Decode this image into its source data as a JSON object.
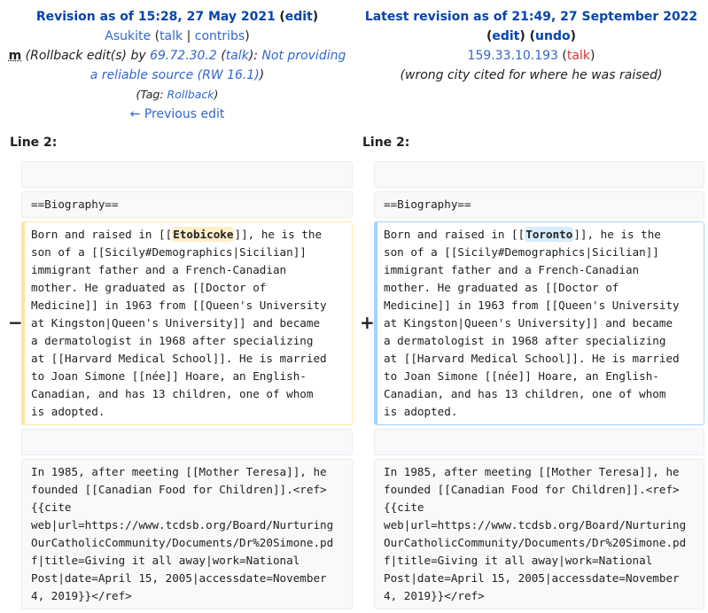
{
  "old": {
    "title": "Revision as of 15:28, 27 May 2021",
    "edit": "edit",
    "user": "Asukite",
    "talk": "talk",
    "contribs": "contribs",
    "minor": "m",
    "summary_prefix": "(Rollback edit(s) by ",
    "ip": "69.72.30.2",
    "ip_talk": "talk",
    "summary_link": "Not providing a reliable source (RW 16.1)",
    "tag_label": "Tag: ",
    "tag": "Rollback",
    "prev": "← Previous edit",
    "line": "Line 2:",
    "marker": "−"
  },
  "new": {
    "title": "Latest revision as of 21:49, 27 September 2022",
    "edit": "edit",
    "undo": "undo",
    "user": "159.33.10.193",
    "talk": "talk",
    "summary": "(wrong city cited for where he was raised)",
    "line": "Line 2:",
    "marker": "+"
  },
  "diff": {
    "bio": "==Biography==",
    "pre": "Born and raised in [[",
    "old_word": "Etobicoke",
    "new_word": "Toronto",
    "post": "]], he is the\nson of a [[Sicily#Demographics|Sicilian]]\nimmigrant father and a French-Canadian\nmother. He graduated as [[Doctor of\nMedicine]] in 1963 from [[Queen's University\nat Kingston|Queen's University]] and became\na dermatologist in 1968 after specializing\nat [[Harvard Medical School]]. He is married\nto Joan Simone [[née]] Hoare, an English-\nCanadian, and has 13 children, one of whom\nis adopted.",
    "para2": "In 1985, after meeting [[Mother Teresa]], he\nfounded [[Canadian Food for Children]].<ref>\n{{cite\nweb|url=https://www.tcdsb.org/Board/Nurturing\nOurCatholicCommunity/Documents/Dr%20Simone.pd\nf|title=Giving it all away|work=National\nPost|date=April 15, 2005|accessdate=November\n4, 2019}}</ref>"
  }
}
